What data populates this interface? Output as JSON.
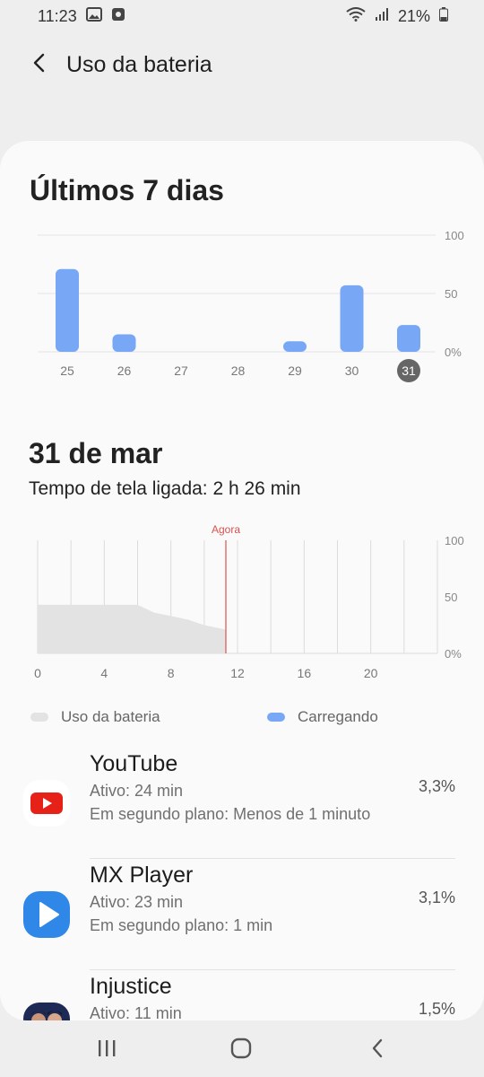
{
  "status_bar": {
    "time": "11:23",
    "battery_percent": "21%",
    "icons": [
      "gallery-icon",
      "screen-record-icon",
      "wifi-icon",
      "signal-icon",
      "battery-icon"
    ]
  },
  "app_bar": {
    "title": "Uso da bateria",
    "back_icon": "back-arrow-icon"
  },
  "last7": {
    "title": "Últimos 7 dias"
  },
  "chart_data": [
    {
      "type": "bar",
      "title": "Últimos 7 dias",
      "categories": [
        "25",
        "26",
        "27",
        "28",
        "29",
        "30",
        "31"
      ],
      "values": [
        71,
        15,
        0,
        0,
        9,
        57,
        23
      ],
      "ylim": [
        0,
        100
      ],
      "yticks": [
        "100",
        "50",
        "0%"
      ],
      "selected_category": "31",
      "bar_color": "#78a8f5",
      "grid": true
    },
    {
      "type": "area",
      "x": [
        0,
        2,
        4,
        6,
        7,
        8,
        9,
        10,
        11.3
      ],
      "values": [
        43,
        43,
        43,
        43,
        36,
        33,
        30,
        25,
        21
      ],
      "xticks": [
        "0",
        "4",
        "8",
        "12",
        "16",
        "20"
      ],
      "xlim": [
        0,
        24
      ],
      "yticks": [
        "100",
        "50",
        "0%"
      ],
      "ylim": [
        0,
        100
      ],
      "now_marker": {
        "label": "Agora",
        "x": 11.3,
        "color": "#d9534f"
      },
      "area_color": "#e3e3e3",
      "grid": true
    }
  ],
  "day": {
    "date": "31 de mar",
    "screen_time": "Tempo de tela ligada: 2 h 26 min"
  },
  "legend": {
    "usage_label": "Uso da bateria",
    "usage_color": "#e3e3e3",
    "charging_label": "Carregando",
    "charging_color": "#78a8f5"
  },
  "apps": [
    {
      "name": "YouTube",
      "active": "Ativo: 24 min",
      "background": "Em segundo plano: Menos de 1 minuto",
      "percent": "3,3%",
      "icon": "youtube-icon"
    },
    {
      "name": "MX Player",
      "active": "Ativo: 23 min",
      "background": "Em segundo plano: 1 min",
      "percent": "3,1%",
      "icon": "mx-player-icon"
    },
    {
      "name": "Injustice",
      "active": "Ativo: 11 min",
      "background": "",
      "percent": "1,5%",
      "icon": "injustice-icon"
    }
  ],
  "nav": {
    "icons": [
      "recent-apps-icon",
      "home-icon",
      "nav-back-icon"
    ]
  }
}
